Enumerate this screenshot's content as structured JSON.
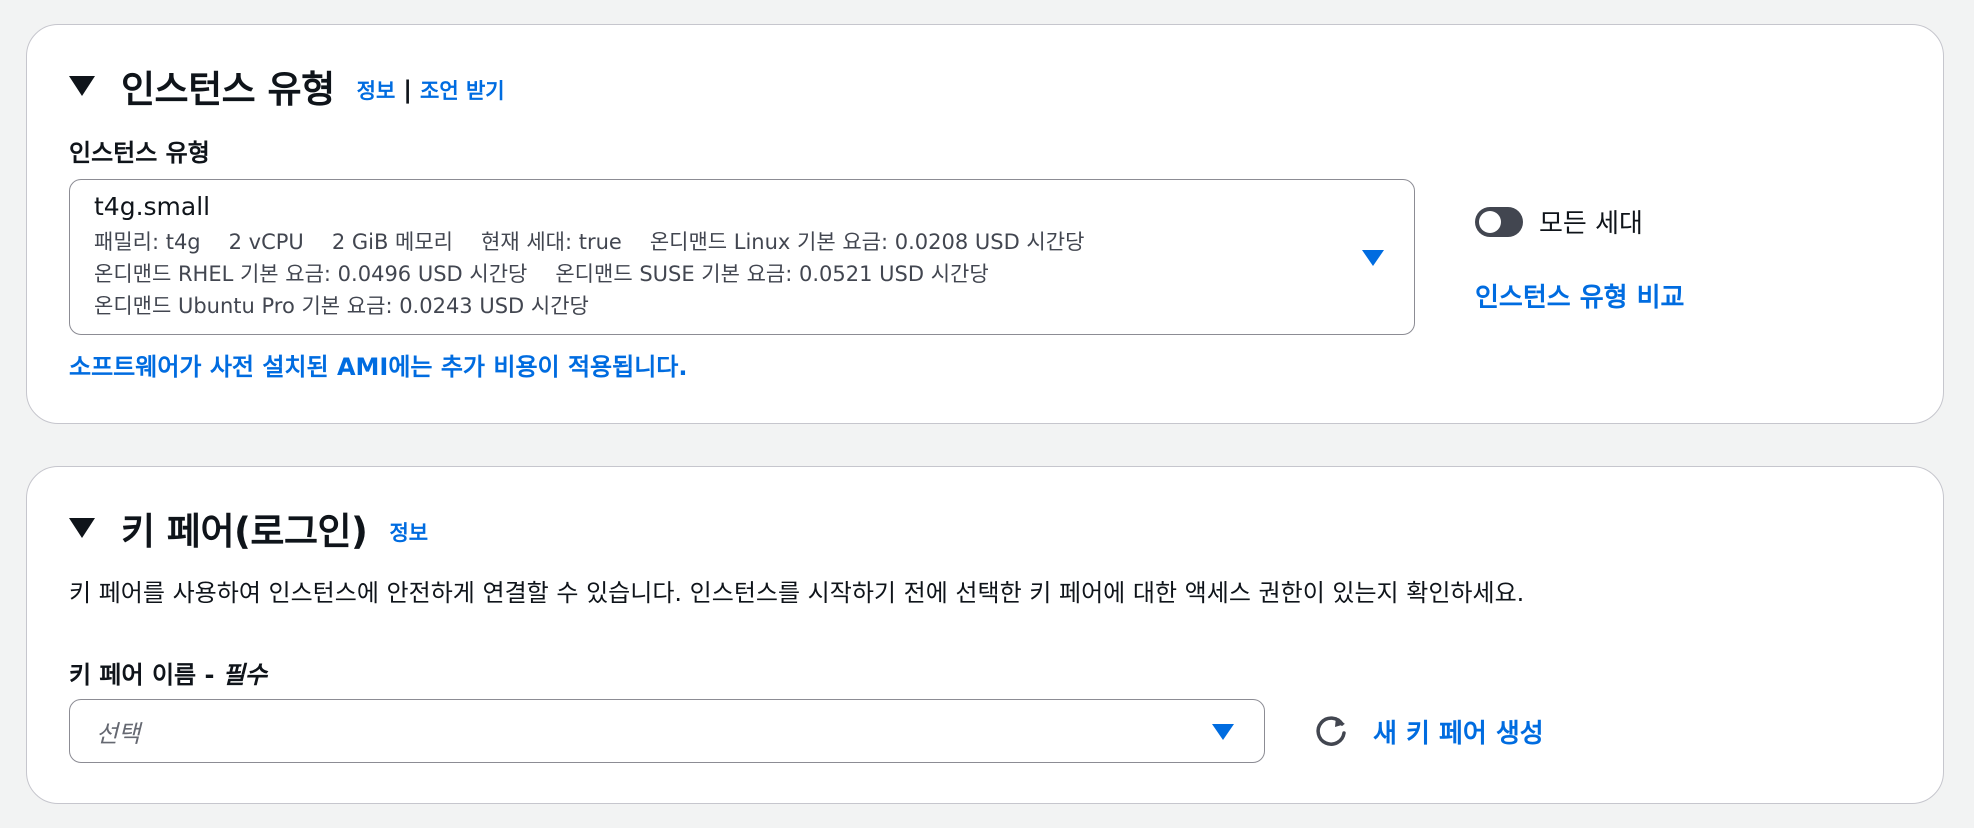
{
  "instance_section": {
    "title": "인스턴스 유형",
    "info_link": "정보",
    "separator": "|",
    "advice_link": "조언 받기",
    "field_label": "인스턴스 유형",
    "selected": {
      "name": "t4g.small",
      "family": "패밀리: t4g",
      "vcpu": "2 vCPU",
      "memory": "2 GiB 메모리",
      "current_generation": "현재 세대: true",
      "linux_price": "온디맨드 Linux 기본 요금: 0.0208 USD 시간당",
      "rhel_price": "온디맨드 RHEL 기본 요금: 0.0496 USD 시간당",
      "suse_price": "온디맨드 SUSE 기본 요금: 0.0521 USD 시간당",
      "ubuntu_price": "온디맨드 Ubuntu Pro 기본 요금: 0.0243 USD 시간당"
    },
    "ami_notice": "소프트웨어가 사전 설치된 AMI에는 추가 비용이 적용됩니다.",
    "toggle_label": "모든 세대",
    "toggle_on": false,
    "compare_link": "인스턴스 유형 비교"
  },
  "key_section": {
    "title": "키 페어(로그인)",
    "info_link": "정보",
    "description": "키 페어를 사용하여 인스턴스에 안전하게 연결할 수 있습니다. 인스턴스를 시작하기 전에 선택한 키 페어에 대한 액세스 권한이 있는지 확인하세요.",
    "field_label": "키 페어 이름 - ",
    "required_label": "필수",
    "placeholder": "선택",
    "create_button": "새 키 페어 생성"
  },
  "colors": {
    "link": "#006ce0",
    "text": "#0f141a",
    "secondary_text": "#424650",
    "border": "#c6c6cd"
  },
  "icons": [
    "caret-down-icon",
    "dropdown-triangle-icon",
    "refresh-icon",
    "toggle-switch"
  ]
}
